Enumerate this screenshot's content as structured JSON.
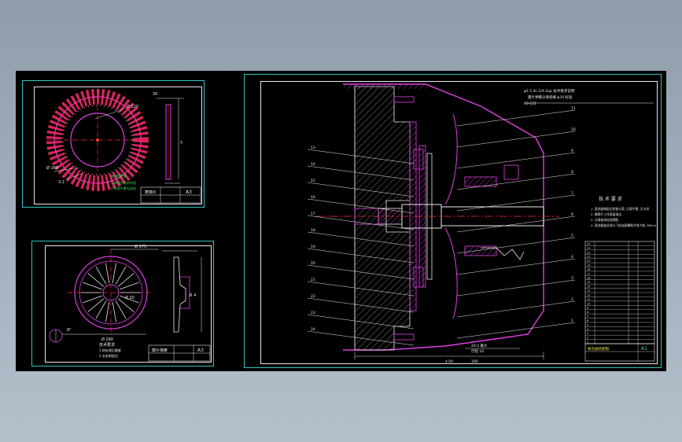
{
  "sheet1": {
    "labels": {
      "top_dim": "30",
      "side_dim": "5",
      "d_outer": "Ø 168",
      "d_mid": "Ø 120",
      "ra": "3.2",
      "note_title": "技术要求",
      "note_1": "1.摩擦片粘结牢固",
      "note_2": "2.表面平整无缺陷",
      "tb_size": "A3",
      "tb_name": "摩擦片"
    }
  },
  "sheet2": {
    "labels": {
      "d1": "Ø 175",
      "d2": "Ø 260",
      "d3": "Ø 30",
      "d4": "R 4",
      "angle": "8°",
      "note_1": "技术要求",
      "note_2": "1.热处理后硬度",
      "note_3": "2.去毛刺锐边",
      "tb_size": "A3",
      "tb_name": "膜片弹簧"
    }
  },
  "sheet3": {
    "header_notes": [
      "φ1.5  SL-1/A  Sap  技术要求说明",
      "膜片弹簧分离指端 φ34  标准",
      "10-121"
    ],
    "tech_title": "技 术 要 求",
    "tech_notes": [
      "1.  离合器装配后检查分离, 分离平稳, 无卡滞",
      "2.  摩擦片工作表面清洁",
      "3.  分离轴承加润滑脂",
      "4.  离合器盖总成与飞轮连接螺栓拧紧力矩 20N·m"
    ],
    "leaders_left": [
      "13",
      "14",
      "15",
      "16",
      "17",
      "18",
      "19",
      "20",
      "21",
      "22",
      "23",
      "24"
    ],
    "leaders_right": [
      "11",
      "10",
      "9",
      "8",
      "7",
      "6",
      "5",
      "4",
      "3",
      "2",
      "1"
    ],
    "bottom_dims": [
      "4.00",
      "20.0  最大",
      "180",
      "行程 10"
    ],
    "bom_rows": [
      "1",
      "2",
      "3",
      "4",
      "5",
      "6",
      "7",
      "8",
      "9",
      "10",
      "11",
      "12",
      "13",
      "14",
      "15",
      "16",
      "17",
      "18",
      "19",
      "20",
      "21",
      "22",
      "23",
      "24"
    ],
    "title_block": {
      "name": "离合器装配图",
      "size": "A1"
    }
  }
}
